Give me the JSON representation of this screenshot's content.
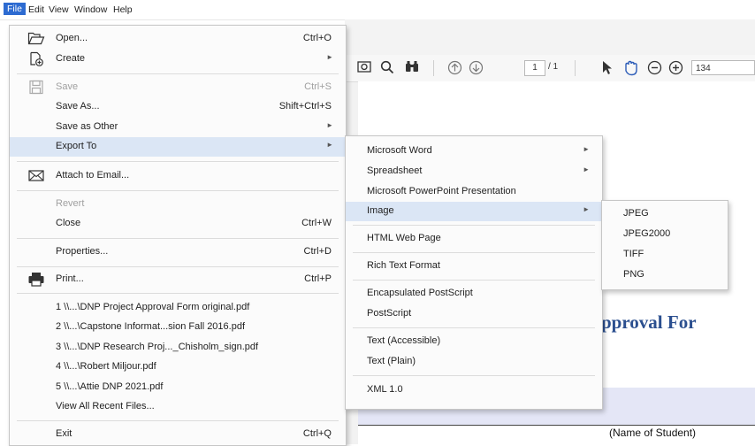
{
  "menubar": {
    "items": [
      "File",
      "Edit",
      "View",
      "Window",
      "Help"
    ]
  },
  "toolbar": {
    "page_current": "1",
    "page_total": "/ 1",
    "zoom": "134"
  },
  "document": {
    "title": "pproval For",
    "subtitle": "(Name of Student)"
  },
  "file_menu": {
    "open": {
      "label": "Open...",
      "shortcut": "Ctrl+O"
    },
    "create": {
      "label": "Create"
    },
    "save": {
      "label": "Save",
      "shortcut": "Ctrl+S"
    },
    "save_as": {
      "label": "Save As...",
      "shortcut": "Shift+Ctrl+S"
    },
    "save_as_other": {
      "label": "Save as Other"
    },
    "export_to": {
      "label": "Export To"
    },
    "attach_email": {
      "label": "Attach to Email..."
    },
    "revert": {
      "label": "Revert"
    },
    "close": {
      "label": "Close",
      "shortcut": "Ctrl+W"
    },
    "properties": {
      "label": "Properties...",
      "shortcut": "Ctrl+D"
    },
    "print": {
      "label": "Print...",
      "shortcut": "Ctrl+P"
    },
    "recent": [
      "1 \\\\...\\DNP Project Approval Form original.pdf",
      "2 \\\\...\\Capstone Informat...sion Fall 2016.pdf",
      "3 \\\\...\\DNP Research Proj..._Chisholm_sign.pdf",
      "4 \\\\...\\Robert Miljour.pdf",
      "5 \\\\...\\Attie DNP 2021.pdf"
    ],
    "view_all_recent": "View All Recent Files...",
    "exit": {
      "label": "Exit",
      "shortcut": "Ctrl+Q"
    }
  },
  "export_menu": {
    "items": [
      "Microsoft Word",
      "Spreadsheet",
      "Microsoft PowerPoint Presentation",
      "Image",
      "HTML Web Page",
      "Rich Text Format",
      "Encapsulated PostScript",
      "PostScript",
      "Text (Accessible)",
      "Text (Plain)",
      "XML 1.0"
    ]
  },
  "image_menu": {
    "items": [
      "JPEG",
      "JPEG2000",
      "TIFF",
      "PNG"
    ]
  },
  "colors": {
    "accent": "#2d6bd1",
    "hover": "#dbe6f5",
    "doc_title": "#2b4f8f"
  }
}
